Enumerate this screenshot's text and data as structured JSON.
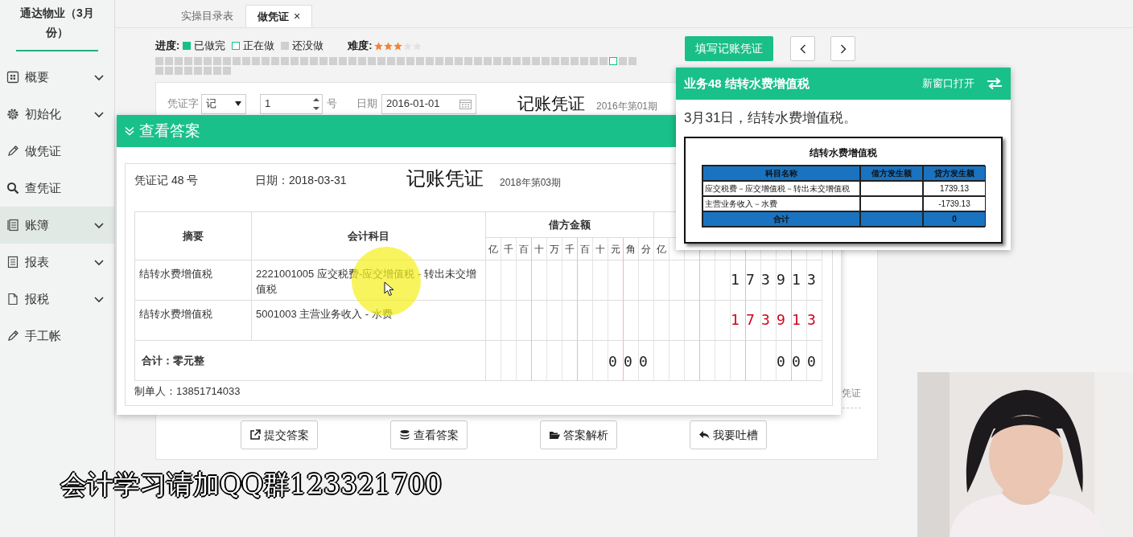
{
  "sidebar": {
    "title": "通达物业（3月份）",
    "items": [
      {
        "label": "概要",
        "has_submenu": true,
        "selected": false
      },
      {
        "label": "初始化",
        "has_submenu": true,
        "selected": false
      },
      {
        "label": "做凭证",
        "has_submenu": false,
        "selected": false
      },
      {
        "label": "查凭证",
        "has_submenu": false,
        "selected": false
      },
      {
        "label": "账簿",
        "has_submenu": true,
        "selected": true
      },
      {
        "label": "报表",
        "has_submenu": true,
        "selected": false
      },
      {
        "label": "报税",
        "has_submenu": true,
        "selected": false
      },
      {
        "label": "手工帐",
        "has_submenu": false,
        "selected": false
      }
    ]
  },
  "tabs": [
    {
      "label": "实操目录表",
      "selected": false
    },
    {
      "label": "做凭证",
      "selected": true,
      "close_glyph": "×"
    }
  ],
  "progress": {
    "label": "进度:",
    "legend": [
      {
        "label": "已做完",
        "kind": "done"
      },
      {
        "label": "正在做",
        "kind": "doing"
      },
      {
        "label": "还没做",
        "kind": "todo"
      }
    ],
    "difficulty_label": "难度:",
    "stars": 3,
    "squares": [
      {
        "current": false
      },
      {
        "current": false
      },
      {
        "current": false
      },
      {
        "current": false
      },
      {
        "current": false
      },
      {
        "current": false
      },
      {
        "current": false
      },
      {
        "current": false
      },
      {
        "current": false
      },
      {
        "current": false
      },
      {
        "current": false
      },
      {
        "current": false
      },
      {
        "current": false
      },
      {
        "current": false
      },
      {
        "current": false
      },
      {
        "current": false
      },
      {
        "current": false
      },
      {
        "current": false
      },
      {
        "current": false
      },
      {
        "current": false
      },
      {
        "current": false
      },
      {
        "current": false
      },
      {
        "current": false
      },
      {
        "current": false
      },
      {
        "current": false
      },
      {
        "current": false
      },
      {
        "current": false
      },
      {
        "current": false
      },
      {
        "current": false
      },
      {
        "current": false
      },
      {
        "current": false
      },
      {
        "current": false
      },
      {
        "current": false
      },
      {
        "current": false
      },
      {
        "current": false
      },
      {
        "current": false
      },
      {
        "current": false
      },
      {
        "current": false
      },
      {
        "current": false
      },
      {
        "current": false
      },
      {
        "current": false
      },
      {
        "current": false
      },
      {
        "current": false
      },
      {
        "current": false
      },
      {
        "current": false
      },
      {
        "current": false
      },
      {
        "current": false
      },
      {
        "current": true
      },
      {
        "current": false
      },
      {
        "current": false
      },
      {
        "current": false
      },
      {
        "current": false
      },
      {
        "current": false
      },
      {
        "current": false
      },
      {
        "current": false
      },
      {
        "current": false
      },
      {
        "current": false
      },
      {
        "current": false
      }
    ]
  },
  "fill_button": "填写记账凭证",
  "voucher_form": {
    "word_label": "凭证字",
    "word": "记",
    "number": "1",
    "number_suffix": "号",
    "date_label": "日期",
    "date": "2016-01-01",
    "title": "记账凭证",
    "period": "2016年第01期",
    "partial_text": "凭证"
  },
  "bottom_buttons": [
    {
      "label": "提交答案"
    },
    {
      "label": "查看答案"
    },
    {
      "label": "答案解析"
    },
    {
      "label": "我要吐槽"
    }
  ],
  "answer_panel": {
    "title": "查看答案",
    "voucher_no": "凭证记 48 号",
    "date": "日期：2018-03-31",
    "voucher_title": "记账凭证",
    "period": "2018年第03期",
    "columns": {
      "summary": "摘要",
      "account": "会计科目",
      "debit": "借方金额"
    },
    "debit_units": [
      "亿",
      "千",
      "百",
      "十",
      "万",
      "千",
      "百",
      "十",
      "元",
      "角",
      "分"
    ],
    "credit_units": [
      "亿"
    ],
    "rows": [
      {
        "summary": "结转水费增值税",
        "account": "2221001005 应交税费-应交增值税 - 转出未交增值税",
        "credit": "173913",
        "negative": false
      },
      {
        "summary": "结转水费增值税",
        "account": "5001003 主营业务收入 - 水费",
        "credit": "173913",
        "negative": true
      }
    ],
    "total": {
      "label": "合计：零元整",
      "debit": "000",
      "credit": "000"
    },
    "maker": "制单人：13851714033"
  },
  "task_popup": {
    "title": "业务48 结转水费增值税",
    "open_link": "新窗口打开",
    "description": "3月31日，结转水费增值税。",
    "document": {
      "title": "结转水费增值税",
      "columns": [
        "科目名称",
        "借方发生额",
        "贷方发生额"
      ],
      "rows": [
        {
          "name": "应交税费－应交增值税－转出未交增值税",
          "credit": "1739.13"
        },
        {
          "name": "主营业务收入－水费",
          "credit": "-1739.13"
        }
      ],
      "total": {
        "name": "合计",
        "credit": "0"
      }
    }
  },
  "caption": "会计学习请加QQ群123321700"
}
